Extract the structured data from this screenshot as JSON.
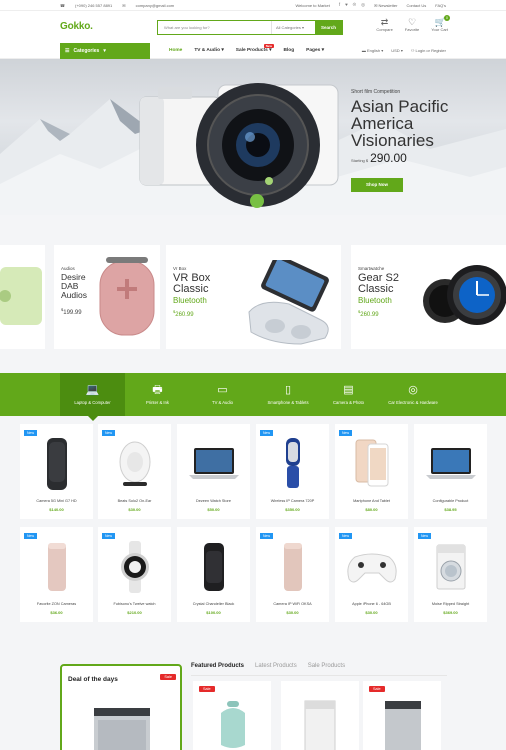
{
  "topbar": {
    "phone": "(+090) 246 557 8891",
    "email": "company@gmail.com",
    "welcome": "Welcome to Market",
    "newsletter": "Newsletter",
    "contact": "Contact Us",
    "faq": "FAQ's"
  },
  "header": {
    "logo": "Gokko.",
    "search_placeholder": "What are you looking for?",
    "search_category": "All Categories",
    "search_button": "Search",
    "compare": "Compare",
    "favorite": "Favorite",
    "cart": "Your Cart",
    "cart_count": "0"
  },
  "nav": {
    "categories": "Categories",
    "items": [
      "Home",
      "TV & Audio",
      "Sale Products",
      "Blog",
      "Pages"
    ],
    "new_tag": "New",
    "language": "English",
    "currency": "USD",
    "account": "Login or Register"
  },
  "hero": {
    "kicker": "Short film Competition",
    "title": "Asian Pacific America Visionaries",
    "price_label": "Starting $",
    "price": "290.00",
    "button": "Shop Now"
  },
  "promos": [
    {
      "sub": "Audios",
      "title": "Desire DAB Audios",
      "price": "199.99"
    },
    {
      "sub": "Vr Box",
      "title": "VR Box Classic",
      "subtitle": "Bluetooth",
      "price": "260.99"
    },
    {
      "sub": "Smartwatche",
      "title": "Gear S2 Classic",
      "subtitle": "Bluetooth",
      "price": "260.99"
    }
  ],
  "category_tabs": [
    "Laptop & Computer",
    "Printer & Ink",
    "TV & Audio",
    "Smartphone & Tablets",
    "Camera & Photo",
    "Car Electronic & Hardware"
  ],
  "new_badge": "New",
  "products_row1": [
    {
      "name": "Camera 5G Mini G7 HD",
      "price": "$140.00",
      "new": true
    },
    {
      "name": "Beats Solo2 On-Ear",
      "price": "$30.00",
      "new": true
    },
    {
      "name": "Dezeen Watch Store",
      "price": "$50.00",
      "new": false
    },
    {
      "name": "Wireless IP Camera 720P",
      "price": "$350.00",
      "new": true
    },
    {
      "name": "Martphone And Tablet",
      "price": "$80.00",
      "new": true
    },
    {
      "name": "Configurable Product",
      "price": "$38.95",
      "new": false
    }
  ],
  "products_row2": [
    {
      "name": "Favorite ZON Cameras",
      "price": "$36.00",
      "new": true
    },
    {
      "name": "Fubisonu's Twelve watch",
      "price": "$210.00",
      "new": true
    },
    {
      "name": "Crystal Chandelier Black",
      "price": "$100.00",
      "new": false
    },
    {
      "name": "Camera IP WiFi OKSA",
      "price": "$30.00",
      "new": true
    },
    {
      "name": "Apple iPhone 6 - 64GB",
      "price": "$30.00",
      "new": true
    },
    {
      "name": "Moise Ripped Straight",
      "price": "$369.00",
      "new": true
    }
  ],
  "bottom": {
    "deal_title": "Deal of the days",
    "sale": "Sale",
    "tabs": [
      "Featured Products",
      "Latest Products",
      "Sale Products"
    ]
  },
  "colors": {
    "accent": "#62a81a",
    "sale": "#e52a2a",
    "new": "#2196f3"
  }
}
